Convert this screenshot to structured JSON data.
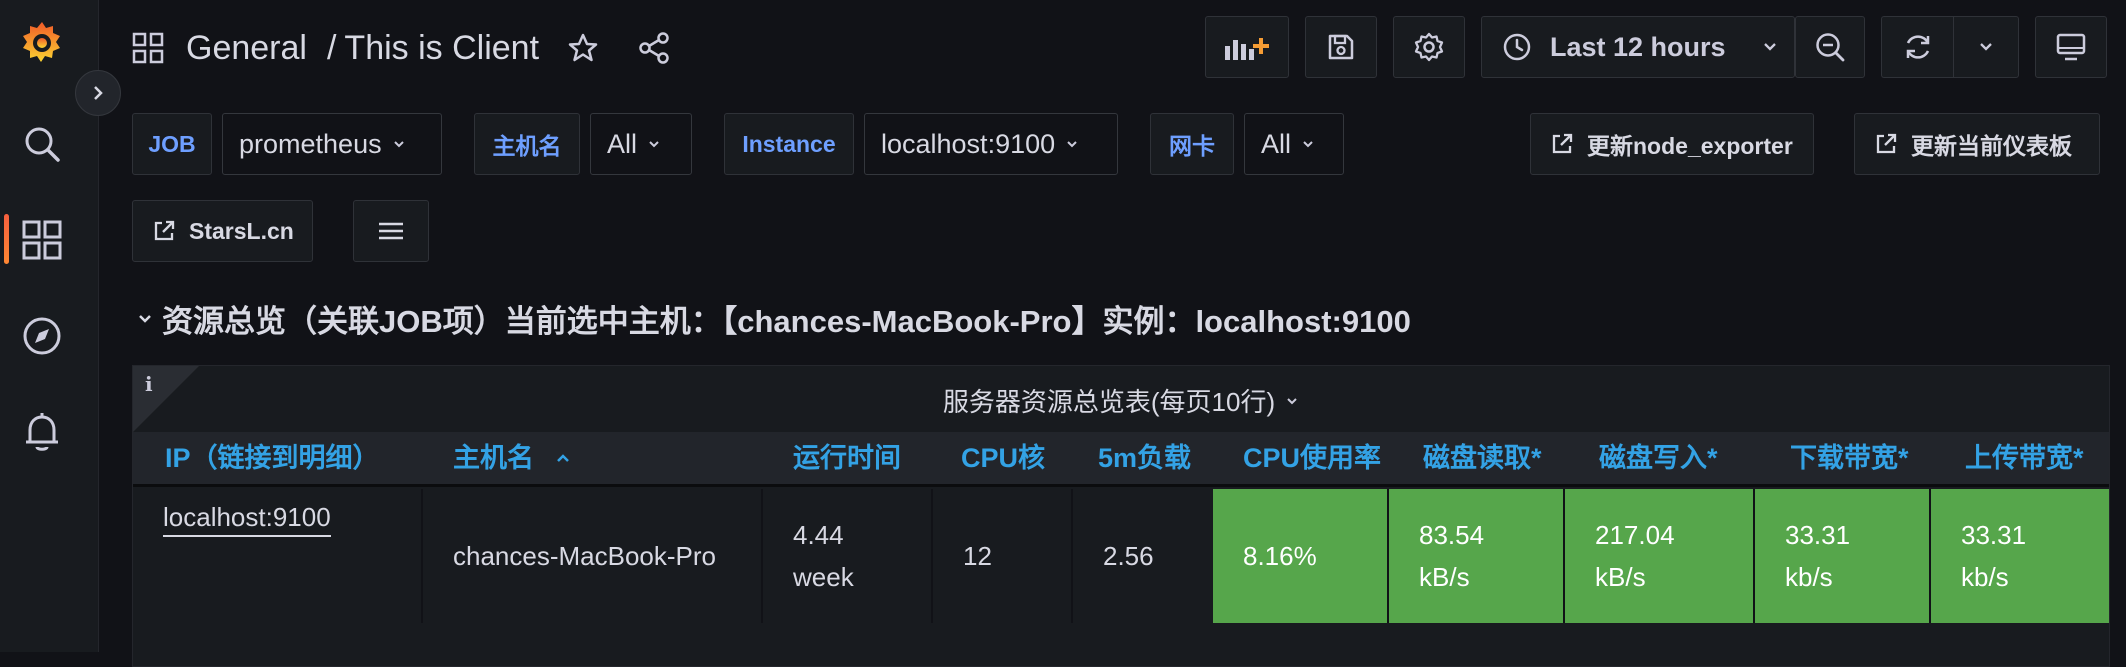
{
  "breadcrumb": {
    "folder": "General",
    "separator": "/",
    "dashboard": "This is Client"
  },
  "toolbar": {
    "time_range": "Last 12 hours"
  },
  "variables": [
    {
      "label": "JOB",
      "value": "prometheus"
    },
    {
      "label": "主机名",
      "value": "All"
    },
    {
      "label": "Instance",
      "value": "localhost:9100"
    },
    {
      "label": "网卡",
      "value": "All"
    }
  ],
  "links": {
    "update_node_exporter": "更新node_exporter",
    "update_dashboard": "更新当前仪表板",
    "starsl": "StarsL.cn"
  },
  "row": {
    "title": "资源总览（关联JOB项）当前选中主机：【chances-MacBook-Pro】实例：localhost:9100"
  },
  "panel": {
    "info": "i",
    "title": "服务器资源总览表(每页10行)",
    "columns": [
      "IP（链接到明细）",
      "主机名",
      "运行时间",
      "CPU核",
      "5m负载",
      "CPU使用率",
      "磁盘读取*",
      "磁盘写入*",
      "下载带宽*",
      "上传带宽*"
    ],
    "rows": [
      {
        "ip": "localhost:9100",
        "hostname": "chances-MacBook-Pro",
        "uptime": "4.44 week",
        "cpu_cores": "12",
        "load5": "2.56",
        "cpu_usage": "8.16%",
        "disk_read": "83.54 kB/s",
        "disk_write": "217.04 kB/s",
        "download": "33.31 kb/s",
        "upload": "33.31 kb/s"
      }
    ]
  },
  "colors": {
    "accent_blue": "#33a2e5",
    "variable_label": "#6e9fff",
    "cell_ok": "#56a64b",
    "brand_orange": "#f46800"
  }
}
